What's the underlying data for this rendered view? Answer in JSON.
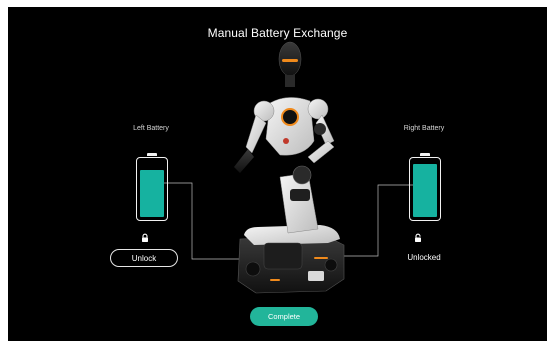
{
  "header": {
    "title": "Manual Battery Exchange"
  },
  "left_battery": {
    "label": "Left Battery",
    "charge_fraction": 0.85,
    "lock_state": "locked",
    "lock_icon": "lock-closed-icon",
    "action_label": "Unlock"
  },
  "right_battery": {
    "label": "Right Battery",
    "charge_fraction": 0.97,
    "lock_state": "unlocked",
    "lock_icon": "lock-open-icon",
    "status_label": "Unlocked"
  },
  "footer": {
    "complete_label": "Complete"
  },
  "colors": {
    "background": "#000000",
    "accent": "#22b59a",
    "battery_fill": "#16b2a0",
    "text": "#ffffff"
  }
}
